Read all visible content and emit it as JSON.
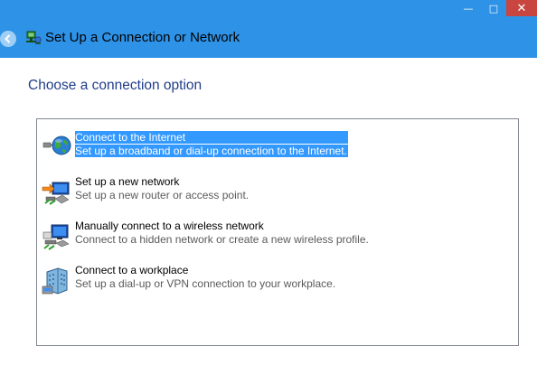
{
  "window": {
    "title": "Set Up a Connection or Network",
    "titlebar_color": "#2e92e6"
  },
  "controls": {
    "minimize_glyph": "—",
    "maximize_glyph": "□",
    "close_glyph": "✕"
  },
  "heading": "Choose a connection option",
  "options": [
    {
      "title": "Connect to the Internet",
      "description": "Set up a broadband or dial-up connection to the Internet.",
      "icon": "globe-icon",
      "selected": true
    },
    {
      "title": "Set up a new network",
      "description": "Set up a new router or access point.",
      "icon": "router-icon",
      "selected": false
    },
    {
      "title": "Manually connect to a wireless network",
      "description": "Connect to a hidden network or create a new wireless profile.",
      "icon": "wireless-network-icon",
      "selected": false
    },
    {
      "title": "Connect to a workplace",
      "description": "Set up a dial-up or VPN connection to your workplace.",
      "icon": "workplace-icon",
      "selected": false
    }
  ],
  "colors": {
    "heading": "#1f3d8a",
    "selection": "#3399ff",
    "close_button": "#c9453f"
  }
}
